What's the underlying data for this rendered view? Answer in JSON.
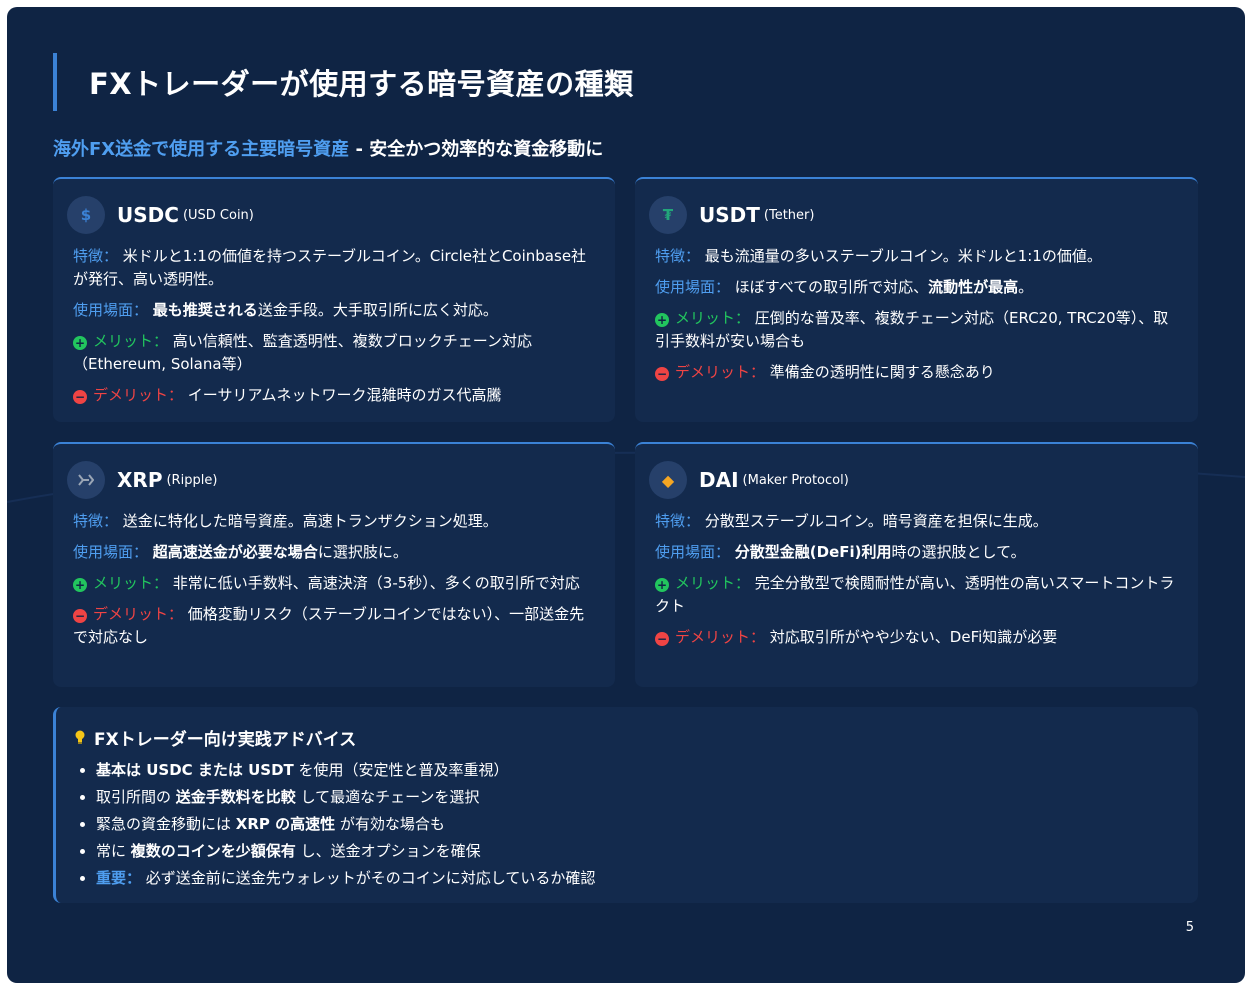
{
  "title": "FXトレーダーが使用する暗号資産の種類",
  "subtitle": {
    "accent": "海外FX送金で使用する主要暗号資産",
    "rest": " - 安全かつ効率的な資金移動に"
  },
  "labels": {
    "feature": "特徴：",
    "usage": "使用場面：",
    "merit": "メリット：",
    "demerit": "デメリット："
  },
  "cards": [
    {
      "name": "USDC",
      "sub": "(USD Coin)",
      "icon": "dollar-icon",
      "icon_glyph": "$",
      "icon_color": "#3b82d6",
      "feature": "米ドルと1:1の価値を持つステーブルコイン。Circle社とCoinbase社が発行、高い透明性。",
      "usage_bold": "最も推奨される",
      "usage_rest": "送金手段。大手取引所に広く対応。",
      "merit": "高い信頼性、監査透明性、複数ブロックチェーン対応（Ethereum, Solana等）",
      "demerit": "イーサリアムネットワーク混雑時のガス代高騰"
    },
    {
      "name": "USDT",
      "sub": "(Tether)",
      "icon": "tether-icon",
      "icon_glyph": "₮",
      "icon_color": "#22a67a",
      "feature": "最も流通量の多いステーブルコイン。米ドルと1:1の価値。",
      "usage_pre": "ほぼすべての取引所で対応、",
      "usage_bold": "流動性が最高",
      "usage_post": "。",
      "merit": "圧倒的な普及率、複数チェーン対応（ERC20, TRC20等）、取引手数料が安い場合も",
      "demerit": "準備金の透明性に関する懸念あり"
    },
    {
      "name": "XRP",
      "sub": "(Ripple)",
      "icon": "xrp-icon",
      "icon_glyph": "⩘",
      "icon_color": "#9aa5b5",
      "feature": "送金に特化した暗号資産。高速トランザクション処理。",
      "usage_bold": "超高速送金が必要な場合",
      "usage_rest": "に選択肢に。",
      "merit": "非常に低い手数料、高速決済（3-5秒）、多くの取引所で対応",
      "demerit": "価格変動リスク（ステーブルコインではない）、一部送金先で対応なし"
    },
    {
      "name": "DAI",
      "sub": "(Maker Protocol)",
      "icon": "diamond-icon",
      "icon_glyph": "◆",
      "icon_color": "#f5a623",
      "feature": "分散型ステーブルコイン。暗号資産を担保に生成。",
      "usage_bold": "分散型金融(DeFi)利用",
      "usage_rest": "時の選択肢として。",
      "merit": "完全分散型で検閲耐性が高い、透明性の高いスマートコントラクト",
      "demerit": "対応取引所がやや少ない、DeFi知識が必要"
    }
  ],
  "advice": {
    "title": "FXトレーダー向け実践アドバイス",
    "items": [
      {
        "bold": "基本は USDC または USDT",
        "rest": " を使用（安定性と普及率重視）"
      },
      {
        "pre": "取引所間の ",
        "bold": "送金手数料を比較",
        "rest": " して最適なチェーンを選択"
      },
      {
        "pre": "緊急の資金移動には ",
        "bold": "XRP の高速性",
        "rest": " が有効な場合も"
      },
      {
        "pre": "常に ",
        "bold": "複数のコインを少額保有",
        "rest": " し、送金オプションを確保"
      },
      {
        "label": "重要：",
        "rest": " 必ず送金前に送金先ウォレットがそのコインに対応しているか確認"
      }
    ]
  },
  "page_number": "5"
}
